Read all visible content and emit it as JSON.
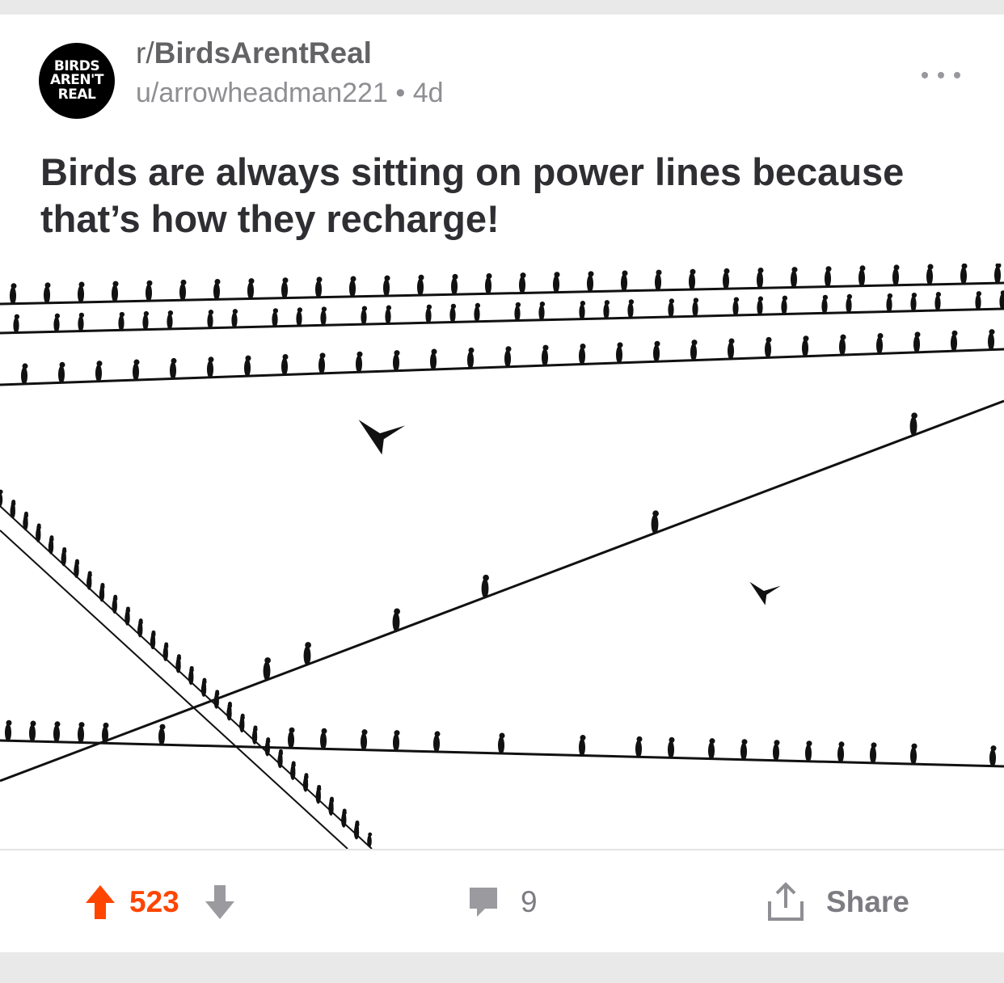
{
  "post": {
    "avatar_lines": [
      "BIRDS",
      "AREN'T",
      "REAL"
    ],
    "subreddit_prefix": "r/",
    "subreddit_name": "BirdsArentReal",
    "author": "u/arrowheadman221",
    "separator": "•",
    "age": "4d",
    "title": "Birds are always sitting on power lines because that’s how they recharge!"
  },
  "image": {
    "description_icon": "birds-on-power-lines-image"
  },
  "actions": {
    "upvotes": "523",
    "comments": "9",
    "share_label": "Share"
  },
  "colors": {
    "upvote_active": "#ff4500",
    "muted": "#7c7c82",
    "title": "#2f2f33"
  }
}
